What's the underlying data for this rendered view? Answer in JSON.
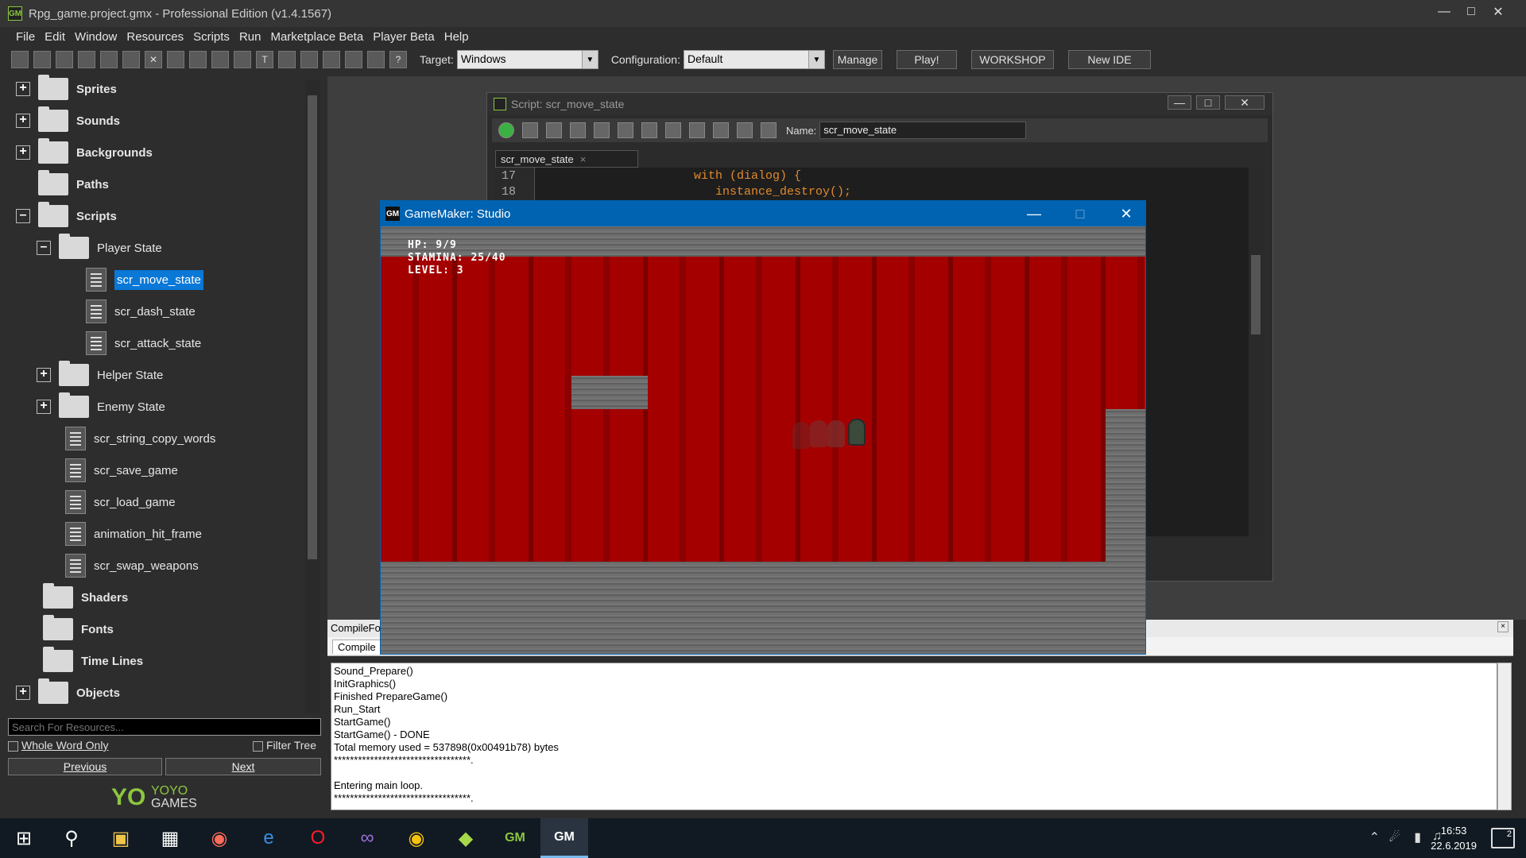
{
  "ide": {
    "window_title": "Rpg_game.project.gmx  -  Professional Edition (v1.4.1567)",
    "menu": [
      "File",
      "Edit",
      "Window",
      "Resources",
      "Scripts",
      "Run",
      "Marketplace Beta",
      "Player Beta",
      "Help"
    ],
    "toolbar": {
      "target_label": "Target:",
      "target_value": "Windows",
      "config_label": "Configuration:",
      "config_value": "Default",
      "manage_label": "Manage",
      "play_label": "Play!",
      "workshop_label": "WORKSHOP",
      "newide_label": "New IDE"
    }
  },
  "tree": {
    "sprites": "Sprites",
    "sounds": "Sounds",
    "backgrounds": "Backgrounds",
    "paths": "Paths",
    "scripts": "Scripts",
    "player_state": "Player State",
    "scr_move_state": "scr_move_state",
    "scr_dash_state": "scr_dash_state",
    "scr_attack_state": "scr_attack_state",
    "helper_state": "Helper State",
    "enemy_state": "Enemy State",
    "scr_string_copy_words": "scr_string_copy_words",
    "scr_save_game": "scr_save_game",
    "scr_load_game": "scr_load_game",
    "animation_hit_frame": "animation_hit_frame",
    "scr_swap_weapons": "scr_swap_weapons",
    "shaders": "Shaders",
    "fonts": "Fonts",
    "time_lines": "Time Lines",
    "objects": "Objects",
    "search_placeholder": "Search For Resources...",
    "whole_word": "Whole Word Only",
    "filter_tree": "Filter Tree",
    "previous": "Previous",
    "next": "Next",
    "logo_top": "YOYO",
    "logo_bottom": "GAMES"
  },
  "script_window": {
    "title": "Script: scr_move_state",
    "name_label": "Name:",
    "name_value": "scr_move_state",
    "tab": "scr_move_state",
    "lines": [
      {
        "n": "17",
        "code": "with (dialog) {"
      },
      {
        "n": "18",
        "code": "   instance_destroy();"
      }
    ]
  },
  "game_window": {
    "title": "GameMaker: Studio",
    "hud_hp": "HP: 9/9",
    "hud_stamina": "STAMINA: 25/40",
    "hud_level": "LEVEL: 3"
  },
  "compile": {
    "header": "CompileFo",
    "tab": "Compile",
    "output": [
      "Sound_Prepare()",
      "InitGraphics()",
      "Finished PrepareGame()",
      "Run_Start",
      "StartGame()",
      "StartGame() - DONE",
      "Total memory used = 537898(0x00491b78) bytes",
      "**********************************.",
      "",
      "Entering main loop.",
      "**********************************."
    ]
  },
  "taskbar": {
    "time": "16:53",
    "date": "22.6.2019",
    "notifications": "2"
  }
}
